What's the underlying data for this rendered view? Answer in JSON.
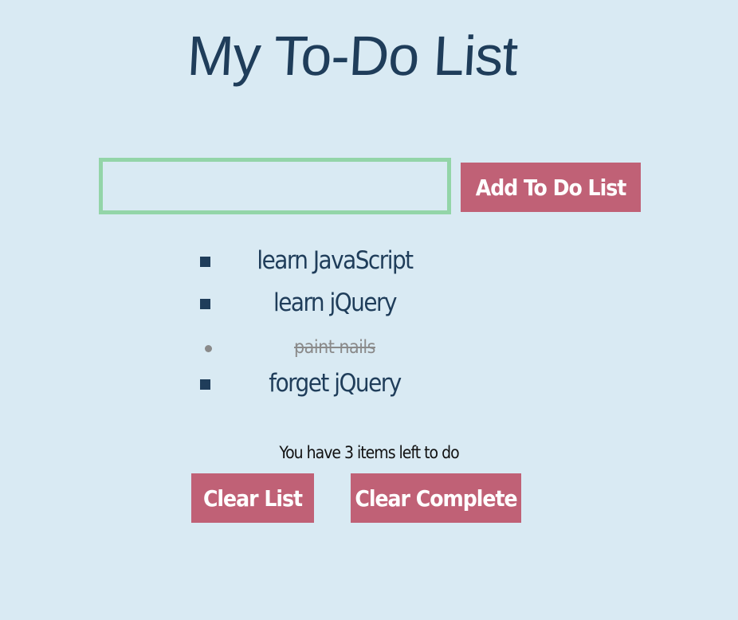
{
  "page": {
    "title": "My To-Do List"
  },
  "form": {
    "input_value": "",
    "input_placeholder": "",
    "add_button_label": "Add To Do List"
  },
  "todos": [
    {
      "text": "learn JavaScript",
      "completed": false
    },
    {
      "text": "learn jQuery",
      "completed": false
    },
    {
      "text": "paint nails",
      "completed": true
    },
    {
      "text": "forget jQuery",
      "completed": false
    }
  ],
  "status": {
    "remaining_text": "You have 3 items left to do"
  },
  "actions": {
    "clear_list_label": "Clear List",
    "clear_complete_label": "Clear Complete"
  },
  "colors": {
    "background": "#d9eaf3",
    "text": "#1f3d5a",
    "button": "#c06176",
    "input_border": "#93d5a8",
    "completed": "#8a8a8a"
  }
}
